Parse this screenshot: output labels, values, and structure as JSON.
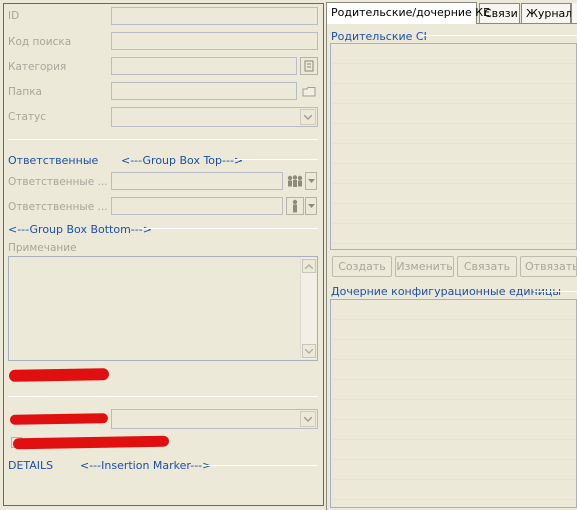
{
  "form": {
    "id_label": "ID",
    "search_code_label": "Код поиска",
    "category_label": "Категория",
    "folder_label": "Папка",
    "status_label": "Статус",
    "responsible_heading": "Ответственные",
    "group_box_top": "<---Group Box Top--->",
    "responsible_1_label": "Ответственные ...",
    "responsible_2_label": "Ответственные ...",
    "group_box_bottom": "<---Group Box Bottom--->",
    "note_label": "Примечание",
    "details_label": "DETAILS",
    "insertion_marker": "<---Insertion Marker--->"
  },
  "tabs": [
    {
      "label": "Родительские/дочерние КЕ",
      "active": true
    },
    {
      "label": "Связи",
      "active": false
    },
    {
      "label": "Журнал",
      "active": false
    }
  ],
  "right": {
    "parent_ci_heading": "Родительские CI",
    "buttons": [
      "Создать",
      "Изменить",
      "Связать",
      "Отвязать"
    ],
    "child_ci_heading": "Дочерние конфигурационные единицы"
  },
  "icons": {
    "category_picker": "book-icon",
    "folder_picker": "folder-icon",
    "group_picker": "group-icon",
    "person_picker": "person-icon"
  },
  "colors": {
    "frame_border": "#d43a3a",
    "heading_blue": "#1c4fa8",
    "redaction": "#e01010"
  }
}
